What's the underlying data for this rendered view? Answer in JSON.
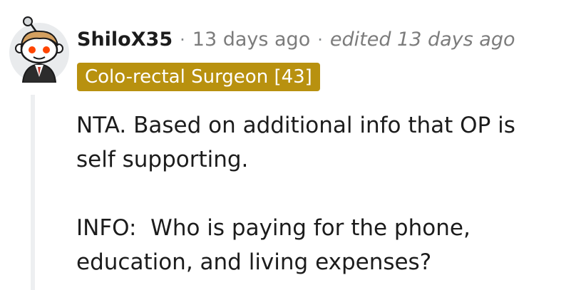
{
  "comment": {
    "author": "ShiloX35",
    "separator": "·",
    "timestamp": "13 days ago",
    "edited": "edited 13 days ago",
    "flair": "Colo-rectal Surgeon [43]",
    "flair_color": "#b8910f",
    "avatar_icon": "snoo-avatar-icon",
    "body": [
      {
        "lines": [
          "NTA. Based on additional info that OP is",
          "self supporting."
        ]
      },
      {
        "lines": [
          "INFO:  Who is paying for the phone,",
          "education, and living expenses?"
        ]
      }
    ]
  }
}
